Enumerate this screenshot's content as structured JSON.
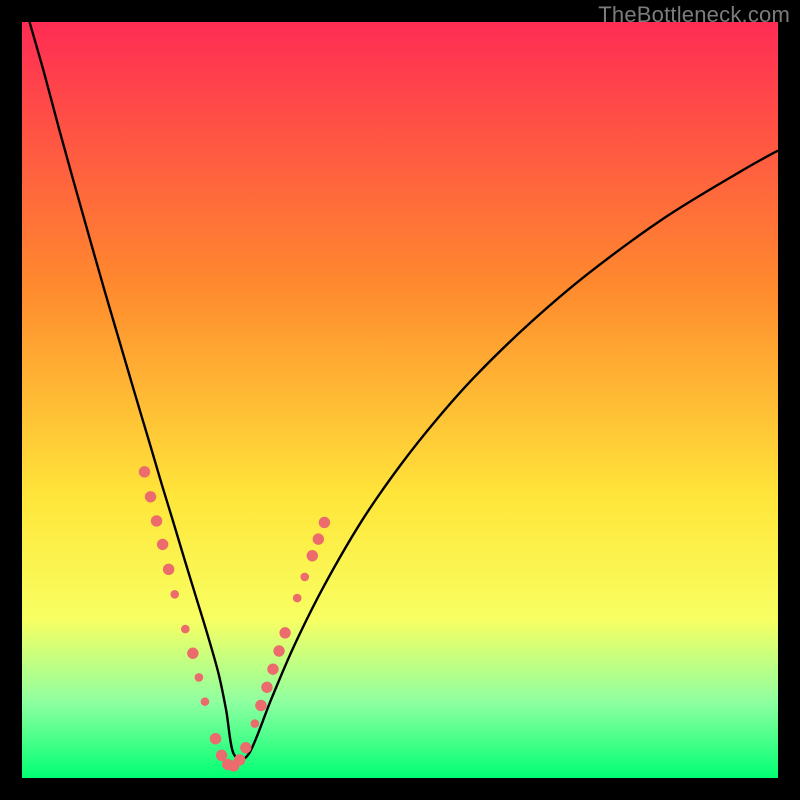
{
  "watermark": "TheBottleneck.com",
  "colors": {
    "black": "#000000",
    "curve": "#000000",
    "marker_fill": "#ec6b6c",
    "marker_stroke": "#ec6b6c",
    "gradient_top": "#ff2c54",
    "gradient_mid1": "#ff8a2e",
    "gradient_mid2": "#ffe63a",
    "gradient_low1": "#f8ff62",
    "gradient_low2": "#8effa0",
    "gradient_bottom": "#00ff73"
  },
  "chart_data": {
    "type": "line",
    "title": "",
    "xlabel": "",
    "ylabel": "",
    "xlim": [
      0,
      100
    ],
    "ylim": [
      0,
      100
    ],
    "grid": false,
    "legend": false,
    "series": [
      {
        "name": "bottleneck-curve",
        "x": [
          1,
          3,
          5,
          7,
          9,
          11,
          13,
          15,
          17,
          18.5,
          20,
          21.5,
          23,
          24.5,
          26,
          27,
          28,
          30,
          33,
          36,
          40,
          45,
          50,
          55,
          60,
          67,
          75,
          85,
          95,
          100
        ],
        "y": [
          100,
          93,
          85.5,
          78.3,
          71.2,
          64.2,
          57.4,
          50.6,
          43.9,
          38.8,
          33.9,
          28.9,
          24.0,
          19.1,
          13.8,
          9.0,
          3.2,
          3.2,
          10.5,
          17.5,
          25.5,
          34.1,
          41.3,
          47.6,
          53.2,
          60.0,
          66.8,
          74.1,
          80.2,
          83.0
        ]
      }
    ],
    "markers_note": "Marker points are decorative sample dots near the curve minimum; exact x positions approximate tick spacing in the source image.",
    "markers": [
      {
        "x": 16.2,
        "y": 40.5,
        "r": 5.2
      },
      {
        "x": 17.0,
        "y": 37.2,
        "r": 5.2
      },
      {
        "x": 17.8,
        "y": 34.0,
        "r": 5.2
      },
      {
        "x": 18.6,
        "y": 30.9,
        "r": 5.2
      },
      {
        "x": 19.4,
        "y": 27.6,
        "r": 5.2
      },
      {
        "x": 20.2,
        "y": 24.3,
        "r": 3.8
      },
      {
        "x": 21.6,
        "y": 19.7,
        "r": 3.8
      },
      {
        "x": 22.6,
        "y": 16.5,
        "r": 5.2
      },
      {
        "x": 23.4,
        "y": 13.3,
        "r": 3.8
      },
      {
        "x": 24.2,
        "y": 10.1,
        "r": 3.8
      },
      {
        "x": 25.6,
        "y": 5.2,
        "r": 5.2
      },
      {
        "x": 26.4,
        "y": 3.0,
        "r": 5.2
      },
      {
        "x": 27.2,
        "y": 1.8,
        "r": 5.2
      },
      {
        "x": 28.0,
        "y": 1.6,
        "r": 5.2
      },
      {
        "x": 28.8,
        "y": 2.4,
        "r": 5.2
      },
      {
        "x": 29.6,
        "y": 4.0,
        "r": 5.2
      },
      {
        "x": 30.8,
        "y": 7.2,
        "r": 3.8
      },
      {
        "x": 31.6,
        "y": 9.6,
        "r": 5.2
      },
      {
        "x": 32.4,
        "y": 12.0,
        "r": 5.2
      },
      {
        "x": 33.2,
        "y": 14.4,
        "r": 5.2
      },
      {
        "x": 34.0,
        "y": 16.8,
        "r": 5.2
      },
      {
        "x": 34.8,
        "y": 19.2,
        "r": 5.2
      },
      {
        "x": 36.4,
        "y": 23.8,
        "r": 3.8
      },
      {
        "x": 37.4,
        "y": 26.6,
        "r": 3.8
      },
      {
        "x": 38.4,
        "y": 29.4,
        "r": 5.2
      },
      {
        "x": 39.2,
        "y": 31.6,
        "r": 5.2
      },
      {
        "x": 40.0,
        "y": 33.8,
        "r": 5.2
      }
    ],
    "background_gradient_stops": [
      {
        "offset": 0.0,
        "color": "#ff2c54"
      },
      {
        "offset": 0.35,
        "color": "#ff8a2e"
      },
      {
        "offset": 0.63,
        "color": "#ffe63a"
      },
      {
        "offset": 0.79,
        "color": "#f8ff62"
      },
      {
        "offset": 0.9,
        "color": "#8effa0"
      },
      {
        "offset": 1.0,
        "color": "#00ff73"
      }
    ]
  }
}
